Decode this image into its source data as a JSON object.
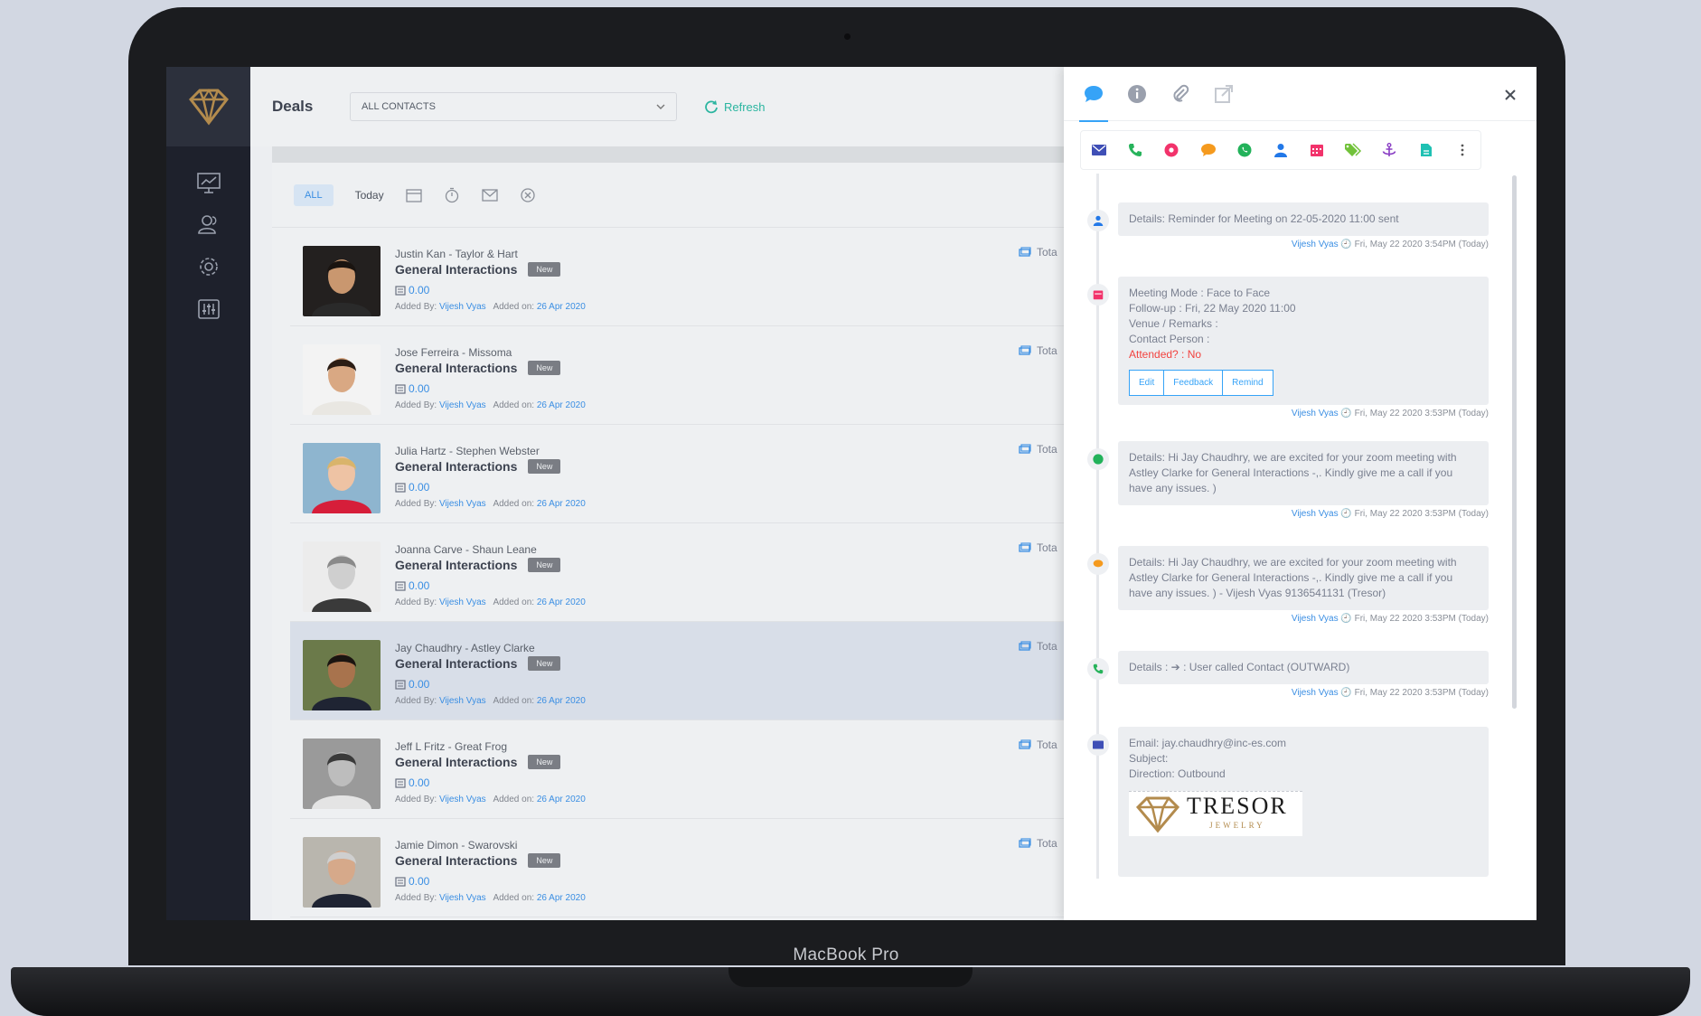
{
  "device": {
    "label": "MacBook Pro"
  },
  "app": {
    "section_title": "Deals",
    "contact_filter": "ALL CONTACTS",
    "refresh_label": "Refresh",
    "filters": {
      "all": "ALL",
      "today": "Today"
    }
  },
  "deals": [
    {
      "name": "Justin Kan - Taylor & Hart",
      "deal": "General Interactions",
      "badge": "New",
      "amount": "0.00",
      "added_by_label": "Added By:",
      "added_by": "Vijesh Vyas",
      "added_on_label": "Added on:",
      "added_on": "26 Apr 2020",
      "total": "Tota",
      "skin": "#c9976f",
      "hair": "#1a1410",
      "shirt": "#2a2a2a",
      "bg": "#23201f"
    },
    {
      "name": "Jose Ferreira - Missoma",
      "deal": "General Interactions",
      "badge": "New",
      "amount": "0.00",
      "added_by_label": "Added By:",
      "added_by": "Vijesh Vyas",
      "added_on_label": "Added on:",
      "added_on": "26 Apr 2020",
      "total": "Tota",
      "skin": "#d9a883",
      "hair": "#2b1d15",
      "shirt": "#e9e7e2",
      "bg": "#f3f3f3"
    },
    {
      "name": "Julia Hartz - Stephen Webster",
      "deal": "General Interactions",
      "badge": "New",
      "amount": "0.00",
      "added_by_label": "Added By:",
      "added_by": "Vijesh Vyas",
      "added_on_label": "Added on:",
      "added_on": "26 Apr 2020",
      "total": "Tota",
      "skin": "#eec3a4",
      "hair": "#d9b46b",
      "shirt": "#d61e3a",
      "bg": "#8eb5cf"
    },
    {
      "name": "Joanna Carve - Shaun Leane",
      "deal": "General Interactions",
      "badge": "New",
      "amount": "0.00",
      "added_by_label": "Added By:",
      "added_by": "Vijesh Vyas",
      "added_on_label": "Added on:",
      "added_on": "26 Apr 2020",
      "total": "Tota",
      "skin": "#cfcfcf",
      "hair": "#8a8a8a",
      "shirt": "#3a3a3a",
      "bg": "#ececec"
    },
    {
      "name": "Jay Chaudhry - Astley Clarke",
      "deal": "General Interactions",
      "badge": "New",
      "amount": "0.00",
      "added_by_label": "Added By:",
      "added_by": "Vijesh Vyas",
      "added_on_label": "Added on:",
      "added_on": "26 Apr 2020",
      "total": "Tota",
      "skin": "#a8734d",
      "hair": "#1b1511",
      "shirt": "#1f2433",
      "bg": "#6b7a4a"
    },
    {
      "name": "Jeff L Fritz - Great Frog",
      "deal": "General Interactions",
      "badge": "New",
      "amount": "0.00",
      "added_by_label": "Added By:",
      "added_by": "Vijesh Vyas",
      "added_on_label": "Added on:",
      "added_on": "26 Apr 2020",
      "total": "Tota",
      "skin": "#bdbdbd",
      "hair": "#3a3a3a",
      "shirt": "#e4e4e4",
      "bg": "#9a9a9a"
    },
    {
      "name": "Jamie Dimon - Swarovski",
      "deal": "General Interactions",
      "badge": "New",
      "amount": "0.00",
      "added_by_label": "Added By:",
      "added_by": "Vijesh Vyas",
      "added_on_label": "Added on:",
      "added_on": "26 Apr 2020",
      "total": "Tota",
      "skin": "#d6a98a",
      "hair": "#cfcfcf",
      "shirt": "#1f2433",
      "bg": "#b9b6ae"
    }
  ],
  "activity": {
    "e1": {
      "text": "Details: Reminder for Meeting on 22-05-2020 11:00 sent",
      "user": "Vijesh Vyas",
      "time": "Fri, May 22 2020 3:54PM (Today)"
    },
    "e2": {
      "l1": "Meeting Mode : Face to Face",
      "l2": "Follow-up : Fri, 22 May 2020 11:00",
      "l3": "Venue / Remarks :",
      "l4": "Contact Person :",
      "l5": "Attended? : No",
      "btn_edit": "Edit",
      "btn_feedback": "Feedback",
      "btn_remind": "Remind",
      "user": "Vijesh Vyas",
      "time": "Fri, May 22 2020 3:53PM (Today)"
    },
    "e3": {
      "text": "Details: Hi Jay Chaudhry, we are excited for your zoom meeting with Astley Clarke for General Interactions -,. Kindly give me a call if you have any issues. )",
      "user": "Vijesh Vyas",
      "time": "Fri, May 22 2020 3:53PM (Today)"
    },
    "e4": {
      "text": "Details: Hi Jay Chaudhry, we are excited for your zoom meeting with Astley Clarke for General Interactions -,. Kindly give me a call if you have any issues. ) - Vijesh Vyas 9136541131 (Tresor)",
      "user": "Vijesh Vyas",
      "time": "Fri, May 22 2020 3:53PM (Today)"
    },
    "e5": {
      "text": "Details : ➔ : User called Contact (OUTWARD)",
      "user": "Vijesh Vyas",
      "time": "Fri, May 22 2020 3:53PM (Today)"
    },
    "e6": {
      "l1": "Email: jay.chaudhry@inc-es.com",
      "l2": "Subject:",
      "l3": "Direction: Outbound",
      "logo_text": "TRESOR",
      "logo_sub": "JEWELRY"
    }
  },
  "colors": {
    "accent": "#36a3f7",
    "teal": "#2bb5a0",
    "gold": "#b38b4d",
    "sidebar": "#1e212c"
  }
}
